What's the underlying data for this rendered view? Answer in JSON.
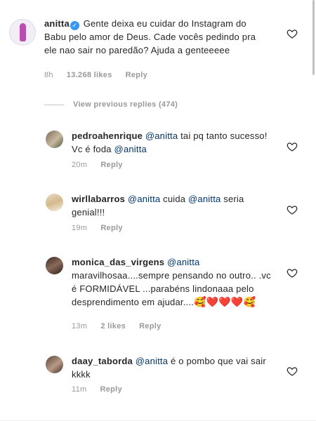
{
  "main_comment": {
    "username": "anitta",
    "text": "Gente deixa eu cuidar do Instagram do Babu pelo amor de Deus. Cade vocês pedindo pra ele nao sair no paredão? Ajuda a genteeeee",
    "age": "8h",
    "likes": "13.268 likes",
    "reply_label": "Reply"
  },
  "view_previous": "View previous replies (474)",
  "replies": [
    {
      "username": "pedroahenrique",
      "mention": "@anitta",
      "text": "tai pq tanto sucesso! Vc é foda",
      "mention2": "@anitta",
      "age": "20m",
      "reply_label": "Reply"
    },
    {
      "username": "wirllabarros",
      "mention": "@anitta",
      "text": "cuida",
      "mention2": "@anitta",
      "text2": "seria genial!!!",
      "age": "19m",
      "reply_label": "Reply"
    },
    {
      "username": "monica_das_virgens",
      "mention": "@anitta",
      "text": "maravilhosaa....sempre pensando no outro.. .vc é FORMIDÁVEL ...parabéns lindonaaa pelo desprendimento em ajudar....",
      "emojis": [
        "🥰",
        "❤️",
        "❤️",
        "❤️",
        "🥰"
      ],
      "age": "13m",
      "likes": "2 likes",
      "reply_label": "Reply"
    },
    {
      "username": "daay_taborda",
      "mention": "@anitta",
      "text": "é o pombo que vai sair kkkk",
      "age": "11m",
      "reply_label": "Reply"
    }
  ],
  "icons": {
    "verified": "verified-badge-icon",
    "heart": "heart-outline-icon"
  },
  "colors": {
    "text": "#262626",
    "mention": "#003569",
    "meta": "#999999",
    "verified": "#3897f0"
  }
}
